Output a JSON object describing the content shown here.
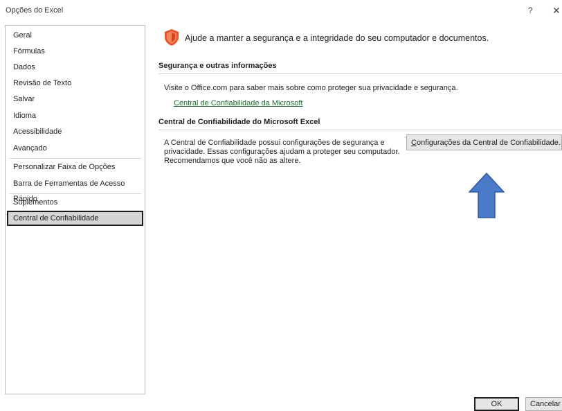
{
  "window": {
    "title": "Opções do Excel",
    "help_glyph": "?",
    "close_glyph": "✕"
  },
  "sidebar": {
    "items": [
      {
        "label": "Geral"
      },
      {
        "label": "Fórmulas"
      },
      {
        "label": "Dados"
      },
      {
        "label": "Revisão de Texto"
      },
      {
        "label": "Salvar"
      },
      {
        "label": "Idioma"
      },
      {
        "label": "Acessibilidade"
      },
      {
        "label": "Avançado"
      },
      {
        "label": "Personalizar Faixa de Opções"
      },
      {
        "label": "Barra de Ferramentas de Acesso Rápido"
      },
      {
        "label": "Suplementos"
      },
      {
        "label": "Central de Confiabilidade"
      }
    ],
    "selected": "Central de Confiabilidade"
  },
  "main": {
    "intro_icon": "shield-icon",
    "intro_text": "Ajude a manter a segurança e a integridade do seu computador e documentos.",
    "security_section": {
      "heading": "Segurança e outras informações",
      "text": "Visite o Office.com para saber mais sobre como proteger sua privacidade e segurança.",
      "link": "Central de Confiabilidade da Microsoft"
    },
    "trust_section": {
      "heading": "Central de Confiabilidade do Microsoft Excel",
      "lines": [
        "A Central de Confiabilidade possui configurações de segurança e",
        "privacidade. Essas configurações ajudam a proteger seu computador.",
        "Recomendamos que você não as altere."
      ],
      "button_accel": "C",
      "button_rest": "onfigurações da Central de Confiabilidade..."
    },
    "annotation_icon": "up-arrow-icon"
  },
  "footer": {
    "ok_label": "OK",
    "cancel_label": "Cancelar"
  },
  "colors": {
    "link": "#1b6e2a",
    "shield": "#e8552b",
    "arrow_fill": "#4a7bc8",
    "arrow_stroke": "#2e5aa3",
    "selected_bg": "#d4d4d4"
  }
}
